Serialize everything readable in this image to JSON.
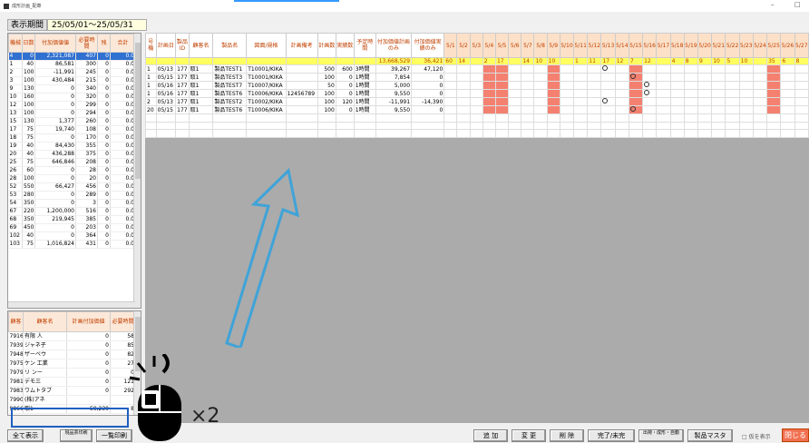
{
  "window": {
    "title": "成形計画_配車",
    "minimize": "–",
    "maximize": "□"
  },
  "period": {
    "label": "表示期間",
    "value": "25/05/01～25/05/31"
  },
  "left_table": {
    "headers": [
      "機械",
      "日数",
      "付加価値値",
      "必要時間",
      "残",
      "合計"
    ],
    "rows": [
      [
        "4",
        "0",
        "2,321,087",
        "407",
        "0",
        "0.0"
      ],
      [
        "1",
        "40",
        "86,581",
        "300",
        "0",
        "0.0"
      ],
      [
        "2",
        "100",
        "-11,991",
        "245",
        "0",
        "0.0"
      ],
      [
        "3",
        "100",
        "430,484",
        "215",
        "0",
        "0.0"
      ],
      [
        "9",
        "130",
        "0",
        "340",
        "0",
        "0.0"
      ],
      [
        "10",
        "160",
        "0",
        "320",
        "0",
        "0.0"
      ],
      [
        "12",
        "100",
        "0",
        "299",
        "0",
        "0.0"
      ],
      [
        "13",
        "100",
        "0",
        "294",
        "0",
        "0.0"
      ],
      [
        "15",
        "130",
        "1,377",
        "260",
        "0",
        "0.0"
      ],
      [
        "17",
        "75",
        "19,740",
        "108",
        "0",
        "0.0"
      ],
      [
        "18",
        "75",
        "0",
        "170",
        "0",
        "0.0"
      ],
      [
        "19",
        "40",
        "84,430",
        "355",
        "0",
        "0.0"
      ],
      [
        "20",
        "40",
        "436,288",
        "375",
        "0",
        "0.0"
      ],
      [
        "25",
        "75",
        "646,846",
        "208",
        "0",
        "0.0"
      ],
      [
        "26",
        "60",
        "0",
        "28",
        "0",
        "0.0"
      ],
      [
        "28",
        "100",
        "0",
        "20",
        "0",
        "0.0"
      ],
      [
        "52",
        "550",
        "66,427",
        "456",
        "0",
        "0.0"
      ],
      [
        "53",
        "280",
        "0",
        "289",
        "0",
        "0.0"
      ],
      [
        "54",
        "350",
        "0",
        "3",
        "0",
        "0.0"
      ],
      [
        "67",
        "220",
        "1,200,000",
        "516",
        "0",
        "0.0"
      ],
      [
        "68",
        "350",
        "219,945",
        "385",
        "0",
        "0.0"
      ],
      [
        "69",
        "450",
        "0",
        "203",
        "0",
        "0.0"
      ],
      [
        "102",
        "40",
        "0",
        "364",
        "0",
        "0.0"
      ],
      [
        "103",
        "75",
        "1,016,824",
        "431",
        "0",
        "0.0"
      ]
    ]
  },
  "customer_table": {
    "headers": [
      "顧客",
      "顧客名",
      "計画付加価値",
      "必要時間"
    ],
    "rows": [
      [
        "7916",
        "有限 人",
        "0",
        "58"
      ],
      [
        "7939",
        "ジャネ子",
        "0",
        "85"
      ],
      [
        "7948",
        "ザーベウ",
        "0",
        "82"
      ],
      [
        "7975",
        "ケン 工業",
        "0",
        "27"
      ],
      [
        "7979",
        "リ ンー",
        "0",
        "0"
      ],
      [
        "7981",
        "デモ三",
        "0",
        "121"
      ],
      [
        "7983",
        "ワムトタブ",
        "0",
        "292"
      ],
      [
        "7990",
        "(株)アネ",
        "",
        ""
      ],
      [
        "9866",
        "取1",
        "59,230",
        "8"
      ]
    ]
  },
  "main_table": {
    "headers": [
      "号機",
      "計画日",
      "製品ID",
      "顧客名",
      "製品名",
      "図面/規格",
      "計画備考",
      "計画数",
      "実績数",
      "予定時間",
      "付加価値計画のみ",
      "付加価値実績のみ"
    ],
    "day_headers": [
      "5/1",
      "5/2",
      "5/3",
      "5/4",
      "5/5",
      "5/6",
      "5/7",
      "5/8",
      "5/9",
      "5/10",
      "5/11",
      "5/12",
      "5/13",
      "5/14",
      "5/15",
      "5/16",
      "5/17",
      "5/18",
      "5/19",
      "5/20",
      "5/21",
      "5/22",
      "5/23",
      "5/24",
      "5/25",
      "5/26",
      "5/27"
    ],
    "summary": {
      "plan_value": "13,668,529",
      "actual_value": "36,421",
      "days": [
        "60",
        "14",
        "",
        "2",
        "17",
        "",
        "14",
        "10",
        "10",
        "",
        "1",
        "11",
        "17",
        "12",
        "7",
        "12",
        "",
        "4",
        "8",
        "9",
        "10",
        "5",
        "10",
        "",
        "35",
        "6",
        "8"
      ]
    },
    "rows": [
      {
        "cells": [
          "1",
          "05/13",
          "177",
          "取1",
          "製品TEST1",
          "T10001/KIKA",
          "",
          "500",
          "600",
          "3時間",
          "39,267",
          "47,120"
        ],
        "red": [
          3,
          4,
          8,
          14,
          24
        ],
        "circle": [
          12
        ]
      },
      {
        "cells": [
          "1",
          "05/15",
          "177",
          "取1",
          "製品TEST3",
          "T10001/KIKA",
          "",
          "100",
          "0",
          "1時間",
          "7,854",
          "0"
        ],
        "red": [
          3,
          4,
          8,
          14,
          24
        ],
        "circle": [
          14
        ]
      },
      {
        "cells": [
          "1",
          "05/16",
          "177",
          "取1",
          "製品TEST7",
          "T10007/KIKA",
          "",
          "50",
          "0",
          "1時間",
          "5,000",
          "0"
        ],
        "red": [
          3,
          4,
          8,
          14,
          24
        ],
        "circle": [
          15
        ]
      },
      {
        "cells": [
          "1",
          "05/16",
          "177",
          "取1",
          "製品TEST6",
          "T10006/KIKA",
          "12456789",
          "100",
          "0",
          "1時間",
          "9,550",
          "0"
        ],
        "red": [
          3,
          4,
          8,
          14,
          24
        ],
        "circle": [
          15
        ]
      },
      {
        "cells": [
          "2",
          "05/13",
          "177",
          "取1",
          "製品TEST2",
          "T10002/KIKA",
          "",
          "100",
          "120",
          "1時間",
          "-11,991",
          "-14,390"
        ],
        "red": [
          3,
          4,
          8,
          14,
          24
        ],
        "circle": [
          12
        ]
      },
      {
        "cells": [
          "20",
          "05/15",
          "177",
          "取1",
          "製品TEST6",
          "T10006/KIKA",
          "",
          "100",
          "0",
          "1時間",
          "9,550",
          "0"
        ],
        "red": [
          3,
          4,
          8,
          14,
          24
        ],
        "circle": [
          14
        ]
      }
    ]
  },
  "overlay": {
    "multiplier": "×2"
  },
  "buttons": {
    "show_all": "全て表示",
    "site_print": "現品票印刷",
    "list_print": "一覧印刷",
    "add": "追 加",
    "change": "変 更",
    "delete": "削 除",
    "complete": "完了/未完",
    "ship": "出荷・成形・自動",
    "product_master": "製品マスタ",
    "show_done": "□ 仮を表示",
    "close": "閉じる"
  },
  "colors": {
    "accent_blue": "#1f5fc0",
    "header_orange": "#c04000",
    "highlight_yellow": "#ffff60",
    "busy_red": "#f48070"
  }
}
